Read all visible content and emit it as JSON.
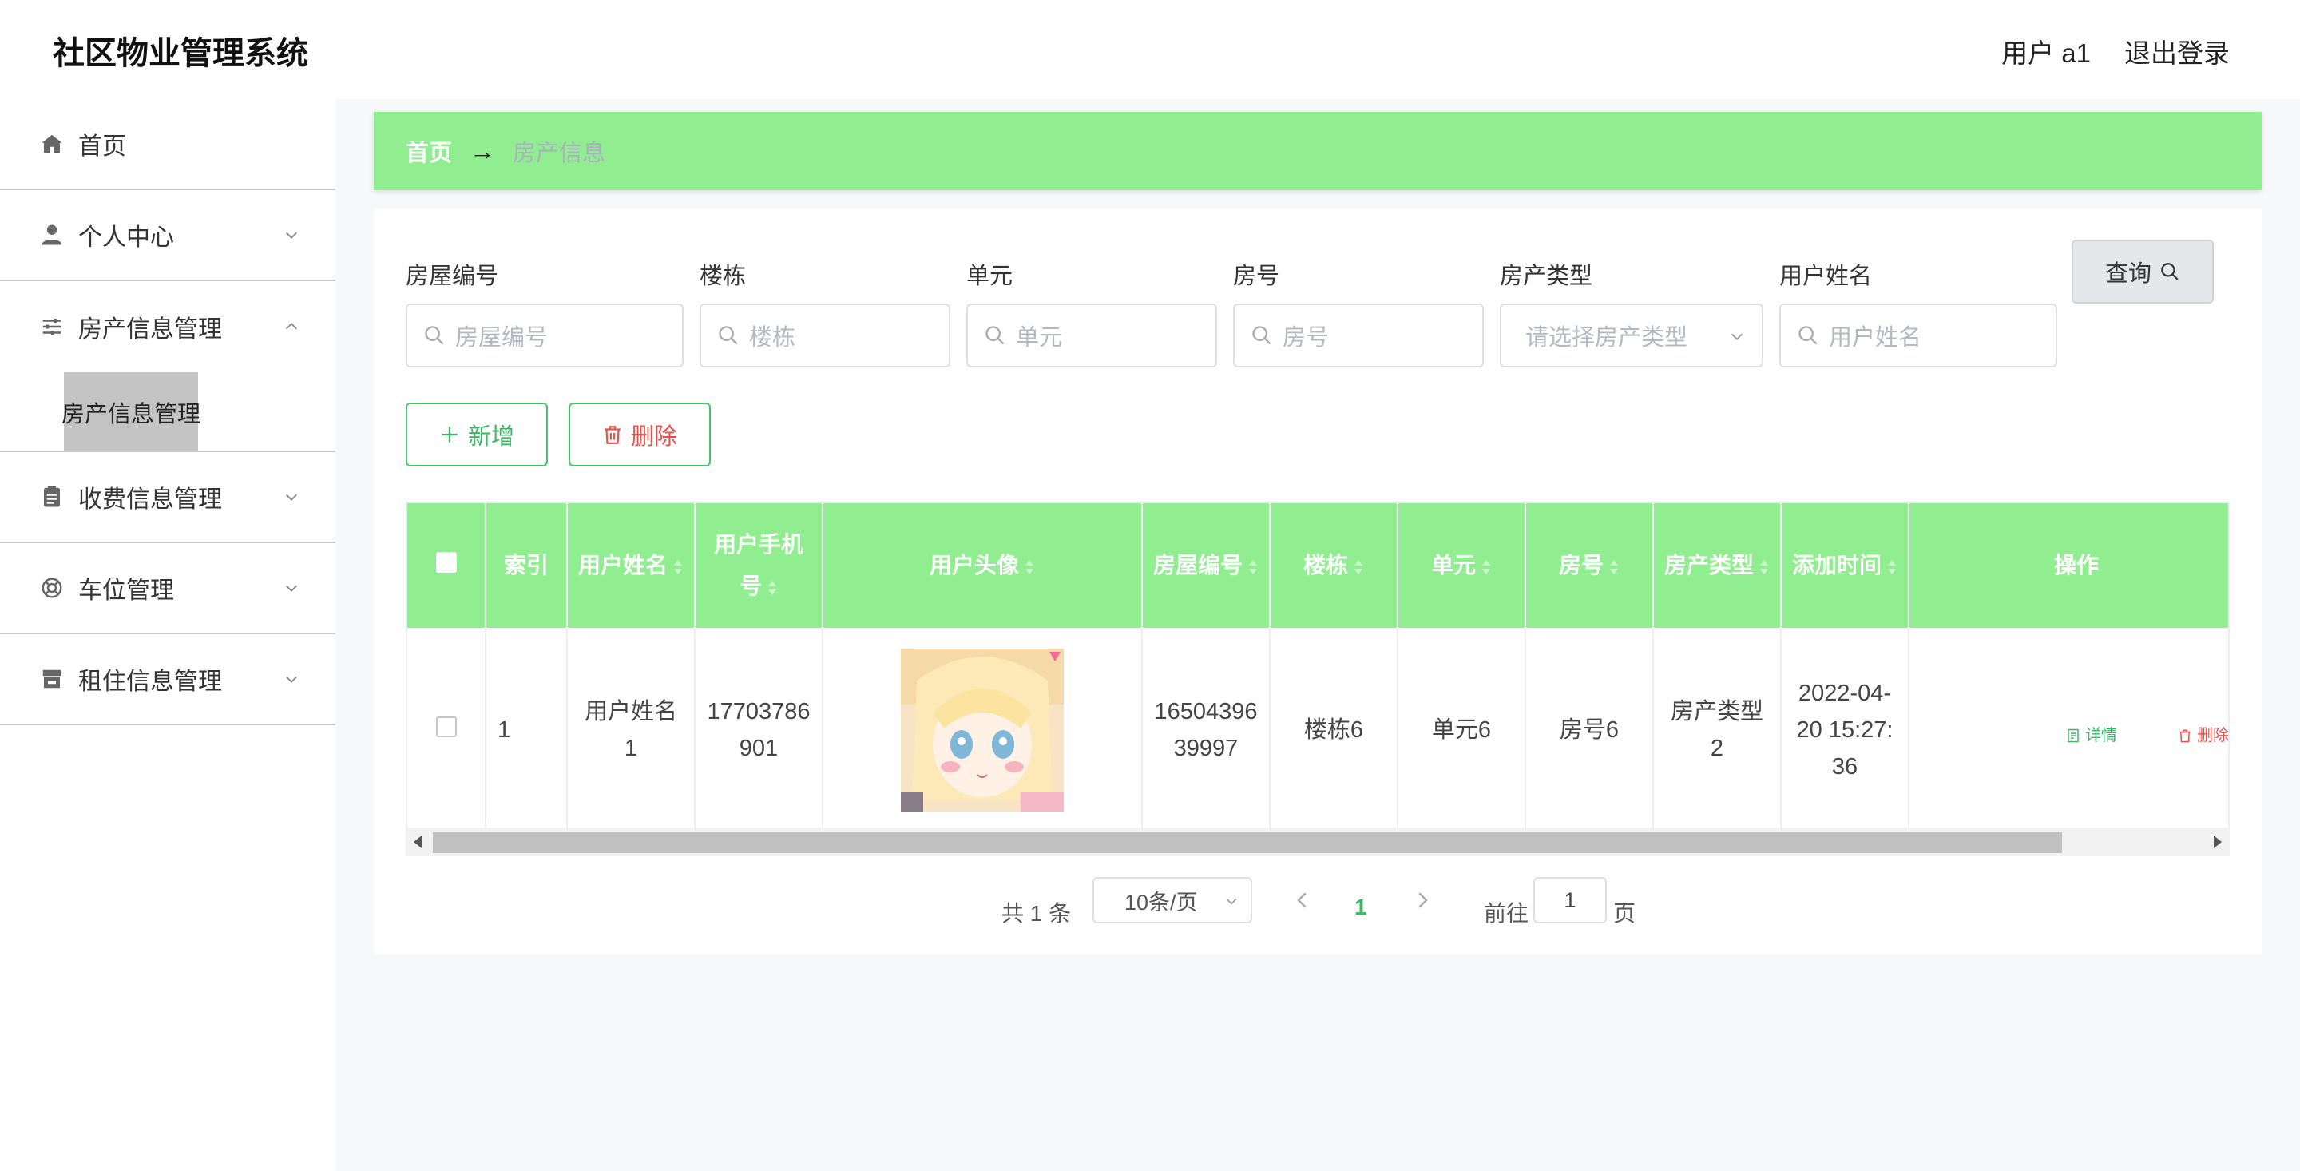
{
  "app": {
    "title": "社区物业管理系统",
    "user_label": "用户 a1",
    "logout_label": "退出登录"
  },
  "sidebar": {
    "items": [
      {
        "label": "首页",
        "icon": "home-icon"
      },
      {
        "label": "个人中心",
        "icon": "user-icon"
      },
      {
        "label": "房产信息管理",
        "icon": "sliders-icon",
        "expanded": true,
        "children": [
          {
            "label": "房产信息管理",
            "active": true
          }
        ]
      },
      {
        "label": "收费信息管理",
        "icon": "clipboard-icon"
      },
      {
        "label": "车位管理",
        "icon": "lifebuoy-icon"
      },
      {
        "label": "租住信息管理",
        "icon": "store-icon"
      }
    ]
  },
  "breadcrumb": {
    "home": "首页",
    "separator": "→",
    "current": "房产信息"
  },
  "search": {
    "fields": [
      {
        "label": "房屋编号",
        "placeholder": "房屋编号"
      },
      {
        "label": "楼栋",
        "placeholder": "楼栋"
      },
      {
        "label": "单元",
        "placeholder": "单元"
      },
      {
        "label": "房号",
        "placeholder": "房号"
      },
      {
        "label": "房产类型",
        "placeholder": "请选择房产类型",
        "type": "select"
      },
      {
        "label": "用户姓名",
        "placeholder": "用户姓名"
      }
    ],
    "query_label": "查询"
  },
  "actions": {
    "add_label": "新增",
    "delete_label": "删除"
  },
  "table": {
    "headers": [
      "索引",
      "用户姓名",
      "用户手机号",
      "用户头像",
      "房屋编号",
      "楼栋",
      "单元",
      "房号",
      "房产类型",
      "添加时间",
      "操作"
    ],
    "rows": [
      {
        "index": "1",
        "user_name": "用户姓名1",
        "phone": "17703786901",
        "house_no": "1650439639997",
        "building": "楼栋6",
        "unit": "单元6",
        "room": "房号6",
        "type": "房产类型2",
        "added": "2022-04-20 15:27:36",
        "op_detail": "详情",
        "op_delete": "删除"
      }
    ]
  },
  "pagination": {
    "total": "共 1 条",
    "page_size": "10条/页",
    "current": "1",
    "goto_label": "前往",
    "goto_value": "1",
    "page_suffix": "页"
  },
  "colors": {
    "accent_green": "#90ee90",
    "text_green": "#3cb564",
    "danger_red": "#e8504a"
  }
}
